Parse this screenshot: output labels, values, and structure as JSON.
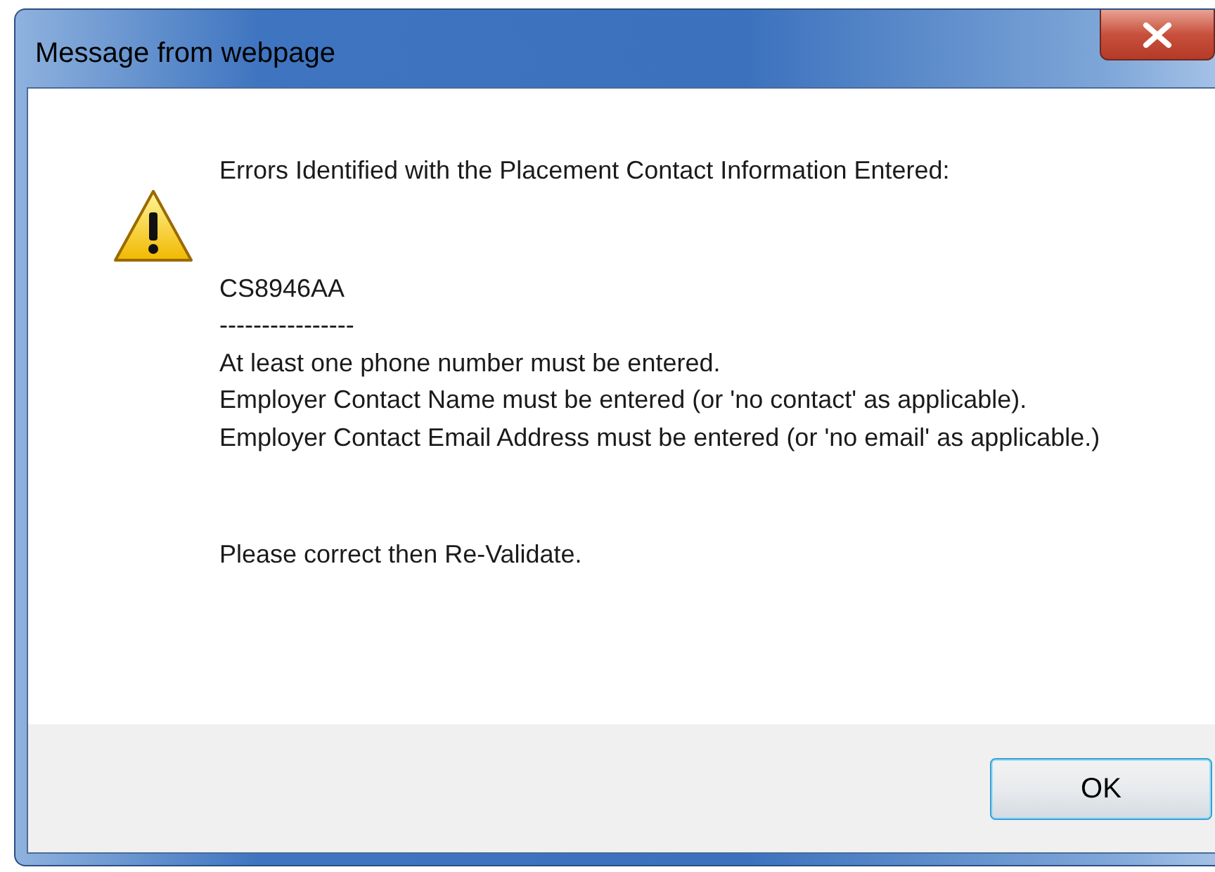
{
  "window": {
    "title": "Message from webpage"
  },
  "message": {
    "heading": "Errors Identified with the Placement Contact Information Entered:",
    "lines": [
      "CS8946AA",
      "----------------",
      "At least one phone number must be entered.",
      "Employer Contact Name must be entered (or 'no contact' as applicable).",
      "Employer Contact Email Address must be entered (or 'no email' as applicable.)"
    ],
    "footer": "Please correct then Re-Validate."
  },
  "buttons": [
    "OK"
  ]
}
